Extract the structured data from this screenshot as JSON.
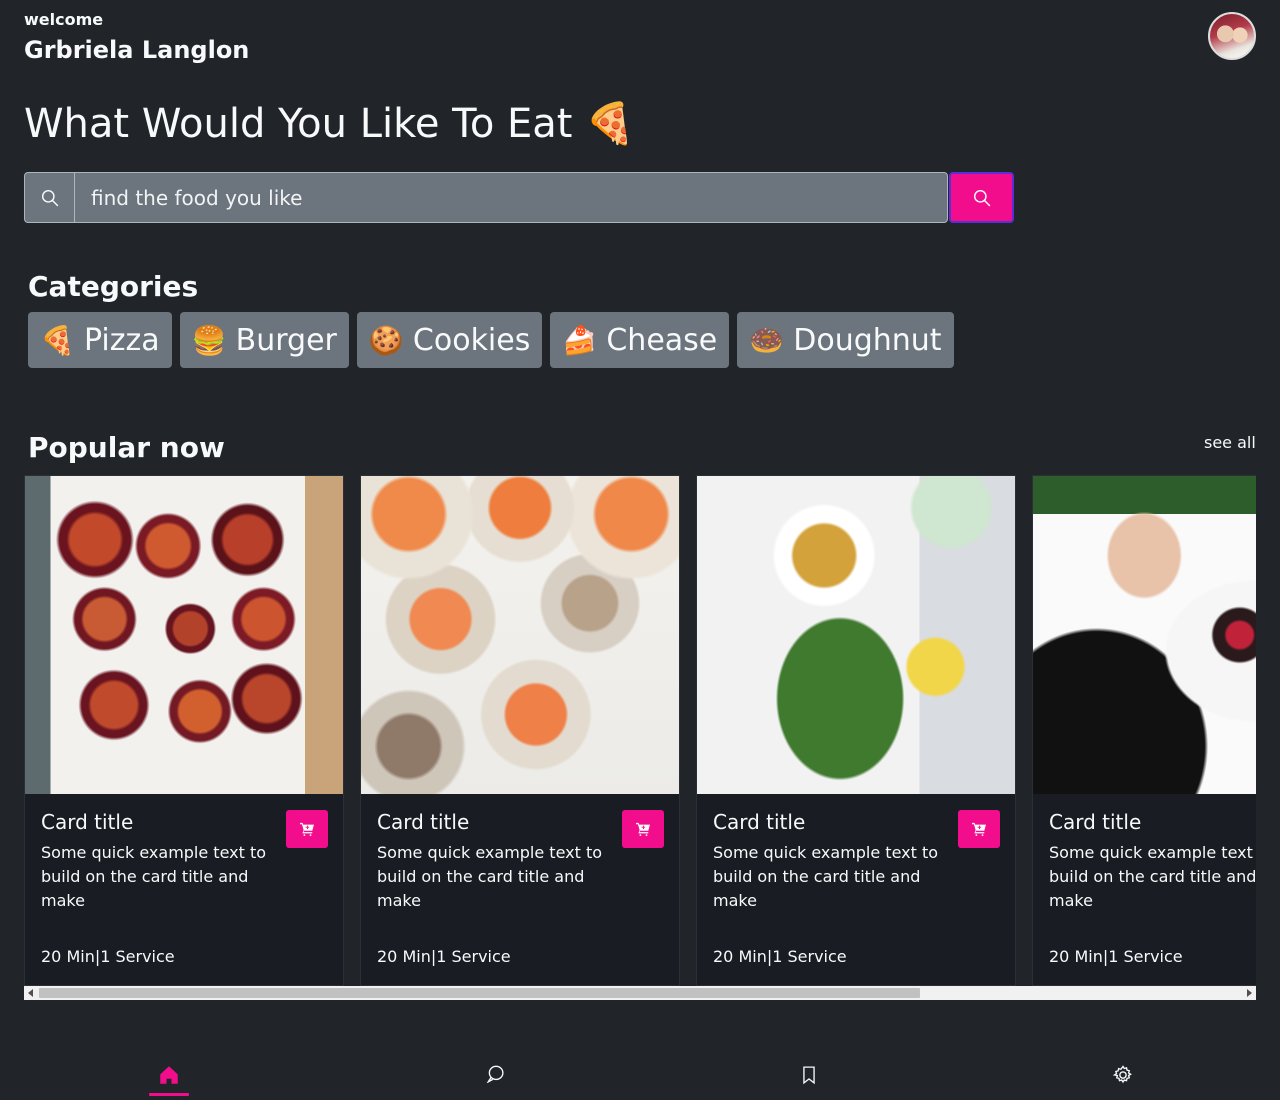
{
  "header": {
    "welcome": "welcome",
    "username": "Grbriela Langlon"
  },
  "headline": "What Would You Like To Eat 🍕",
  "search": {
    "placeholder": "find the food you like"
  },
  "categories": {
    "title": "Categories",
    "items": [
      {
        "emoji": "🍕",
        "label": "Pizza"
      },
      {
        "emoji": "🍔",
        "label": "Burger"
      },
      {
        "emoji": "🍪",
        "label": "Cookies"
      },
      {
        "emoji": "🍰",
        "label": "Chease"
      },
      {
        "emoji": "🍩",
        "label": "Doughnut"
      }
    ]
  },
  "popular": {
    "title": "Popular now",
    "see_all": "see all",
    "cards": [
      {
        "title": "Card title",
        "text": "Some quick example text to build on the card title and make",
        "meta": "20 Min|1 Service"
      },
      {
        "title": "Card title",
        "text": "Some quick example text to build on the card title and make",
        "meta": "20 Min|1 Service"
      },
      {
        "title": "Card title",
        "text": "Some quick example text to build on the card title and make",
        "meta": "20 Min|1 Service"
      },
      {
        "title": "Card title",
        "text": "Some quick example text to build on the card title and make",
        "meta": "20 Min|1 Service"
      }
    ]
  },
  "bottom_nav": {
    "items": [
      {
        "icon": "home-icon",
        "active": true
      },
      {
        "icon": "chat-icon",
        "active": false
      },
      {
        "icon": "bookmark-icon",
        "active": false
      },
      {
        "icon": "gear-icon",
        "active": false
      }
    ]
  },
  "colors": {
    "background": "#212529",
    "accent": "#f20d8c",
    "chip": "#6c757d",
    "card": "#191c22"
  }
}
